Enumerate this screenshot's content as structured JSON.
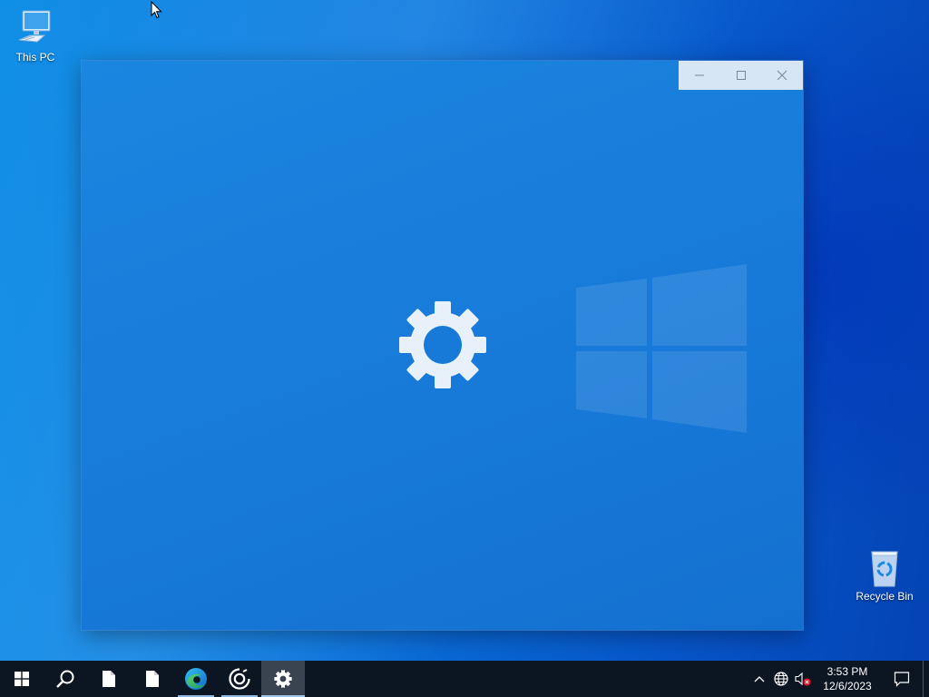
{
  "desktop": {
    "icons": [
      {
        "label": "This PC",
        "icon": "computer-icon"
      },
      {
        "label": "Recycle Bin",
        "icon": "recycle-bin-icon"
      }
    ]
  },
  "window": {
    "state": "loading-splash",
    "splash_icon": "gear-icon",
    "caption": {
      "minimize_icon": "minimize-icon",
      "maximize_icon": "maximize-icon",
      "close_icon": "close-icon"
    },
    "colors": {
      "splash_bg": "#1779d8",
      "caption_bg": "#d6e6f5"
    }
  },
  "taskbar": {
    "items": [
      {
        "icon": "windows-start-icon",
        "running": false,
        "active": false
      },
      {
        "icon": "search-icon",
        "running": false,
        "active": false
      },
      {
        "icon": "document-icon",
        "running": false,
        "active": false
      },
      {
        "icon": "document-icon",
        "running": false,
        "active": false
      },
      {
        "icon": "edge-browser-icon",
        "running": true,
        "active": false
      },
      {
        "icon": "media-player-icon",
        "running": true,
        "active": false
      },
      {
        "icon": "settings-gear-icon",
        "running": true,
        "active": true
      }
    ],
    "tray": {
      "icons": [
        "chevron-up-icon",
        "network-globe-icon",
        "speaker-muted-icon"
      ],
      "time": "3:53 PM",
      "date": "12/6/2023",
      "notification_icon": "action-center-icon"
    },
    "colors": {
      "background": "#0c1622"
    }
  }
}
